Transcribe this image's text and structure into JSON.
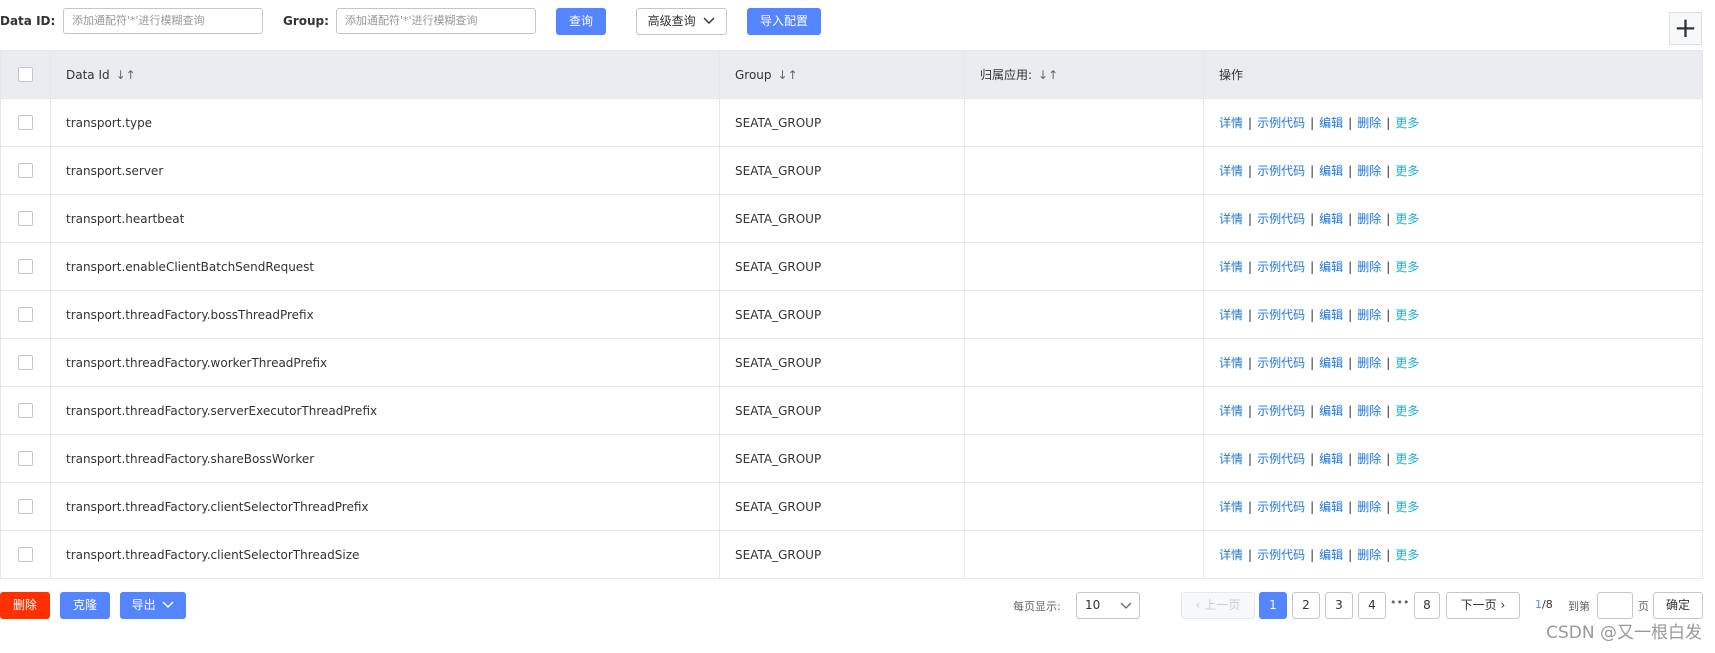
{
  "search": {
    "data_id_label": "Data ID:",
    "data_id_placeholder": "添加通配符'*'进行模糊查询",
    "group_label": "Group:",
    "group_placeholder": "添加通配符'*'进行模糊查询",
    "query_button": "查询",
    "advanced_button": "高级查询",
    "import_button": "导入配置"
  },
  "table": {
    "headers": {
      "data_id": "Data Id",
      "group": "Group",
      "app": "归属应用:",
      "ops": "操作"
    },
    "actions": {
      "detail": "详情",
      "sample": "示例代码",
      "edit": "编辑",
      "delete": "删除",
      "more": "更多"
    },
    "rows": [
      {
        "data_id": "transport.type",
        "group": "SEATA_GROUP",
        "app": ""
      },
      {
        "data_id": "transport.server",
        "group": "SEATA_GROUP",
        "app": ""
      },
      {
        "data_id": "transport.heartbeat",
        "group": "SEATA_GROUP",
        "app": ""
      },
      {
        "data_id": "transport.enableClientBatchSendRequest",
        "group": "SEATA_GROUP",
        "app": ""
      },
      {
        "data_id": "transport.threadFactory.bossThreadPrefix",
        "group": "SEATA_GROUP",
        "app": ""
      },
      {
        "data_id": "transport.threadFactory.workerThreadPrefix",
        "group": "SEATA_GROUP",
        "app": ""
      },
      {
        "data_id": "transport.threadFactory.serverExecutorThreadPrefix",
        "group": "SEATA_GROUP",
        "app": ""
      },
      {
        "data_id": "transport.threadFactory.shareBossWorker",
        "group": "SEATA_GROUP",
        "app": ""
      },
      {
        "data_id": "transport.threadFactory.clientSelectorThreadPrefix",
        "group": "SEATA_GROUP",
        "app": ""
      },
      {
        "data_id": "transport.threadFactory.clientSelectorThreadSize",
        "group": "SEATA_GROUP",
        "app": ""
      }
    ]
  },
  "footer": {
    "delete_button": "删除",
    "clone_button": "克隆",
    "export_button": "导出",
    "page_size_label": "每页显示:",
    "page_size_value": "10",
    "prev_label": "上一页",
    "next_label": "下一页",
    "pages": [
      "1",
      "2",
      "3",
      "4",
      "8"
    ],
    "ellipsis": "•••",
    "page_info_current": "1",
    "page_info_total": "/8",
    "goto_label": "到第",
    "page_unit": "页",
    "confirm_button": "确定"
  },
  "watermark": "CSDN @又一根白发",
  "colors": {
    "primary": "#5584ff",
    "danger": "#ff3000",
    "link": "#2077d9",
    "more_link": "#1bb1d9"
  }
}
